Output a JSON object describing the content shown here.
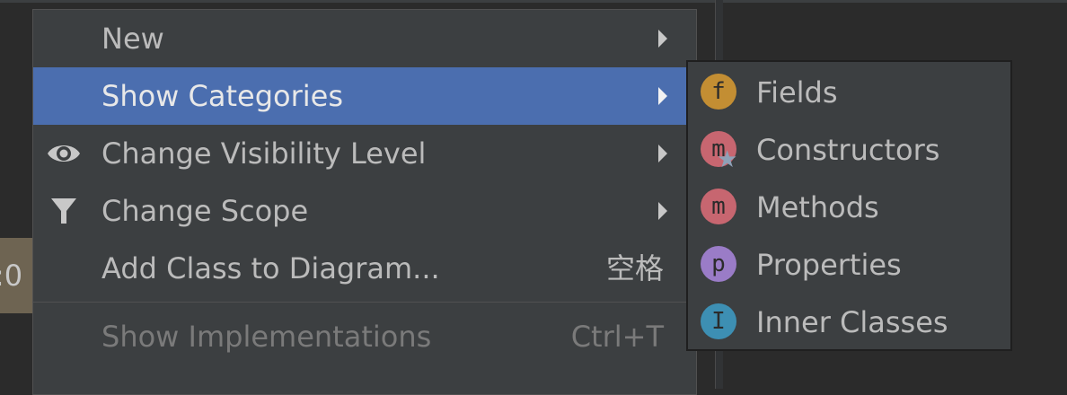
{
  "canvas": {
    "node_fragment": ":0"
  },
  "context_menu": {
    "items": [
      {
        "label": "New",
        "shortcut": "",
        "has_submenu": true,
        "icon": "",
        "state": "normal"
      },
      {
        "label": "Show Categories",
        "shortcut": "",
        "has_submenu": true,
        "icon": "",
        "state": "selected"
      },
      {
        "label": "Change Visibility Level",
        "shortcut": "",
        "has_submenu": true,
        "icon": "eye-icon",
        "state": "normal"
      },
      {
        "label": "Change Scope",
        "shortcut": "",
        "has_submenu": true,
        "icon": "filter-funnel-icon",
        "state": "normal"
      },
      {
        "label": "Add Class to Diagram...",
        "shortcut": "空格",
        "has_submenu": false,
        "icon": "",
        "state": "normal"
      },
      {
        "label": "Show Implementations",
        "shortcut": "Ctrl+T",
        "has_submenu": false,
        "icon": "",
        "state": "disabled"
      }
    ]
  },
  "categories_submenu": {
    "items": [
      {
        "label": "Fields",
        "badge": "f",
        "badge_color": "#c38e33",
        "icon": "field-icon"
      },
      {
        "label": "Constructors",
        "badge": "m",
        "badge_color": "#c76670",
        "icon": "constructor-icon"
      },
      {
        "label": "Methods",
        "badge": "m",
        "badge_color": "#c76670",
        "icon": "method-icon"
      },
      {
        "label": "Properties",
        "badge": "p",
        "badge_color": "#9a7cc7",
        "icon": "property-icon"
      },
      {
        "label": "Inner Classes",
        "badge": "I",
        "badge_color": "#3d8fb3",
        "icon": "inner-class-icon"
      }
    ]
  },
  "colors": {
    "menu_background": "#3c3f41",
    "selection": "#4b6eaf",
    "canvas_background": "#2b2b2b"
  }
}
